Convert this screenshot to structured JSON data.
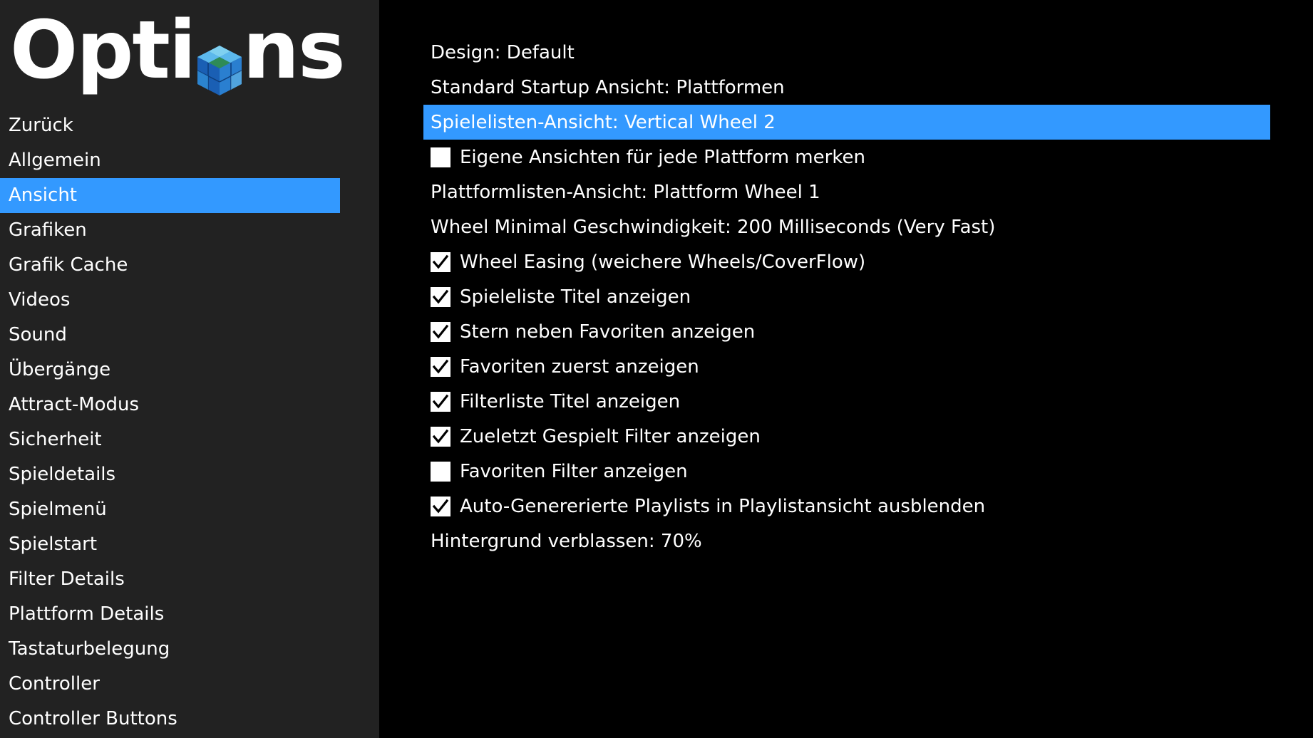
{
  "sidebar": {
    "logo": {
      "text_before": "Opti",
      "text_after": "ns",
      "icon": "cube-icon",
      "icon_colors": [
        "#1a5fb4",
        "#3ba3e8",
        "#7fd0f0",
        "#2e8b57"
      ]
    },
    "items": [
      {
        "label": "Zurück",
        "name": "zurueck",
        "selected": false
      },
      {
        "label": "Allgemein",
        "name": "allgemein",
        "selected": false
      },
      {
        "label": "Ansicht",
        "name": "ansicht",
        "selected": true
      },
      {
        "label": "Grafiken",
        "name": "grafiken",
        "selected": false
      },
      {
        "label": "Grafik Cache",
        "name": "grafik-cache",
        "selected": false
      },
      {
        "label": "Videos",
        "name": "videos",
        "selected": false
      },
      {
        "label": "Sound",
        "name": "sound",
        "selected": false
      },
      {
        "label": "Übergänge",
        "name": "uebergaenge",
        "selected": false
      },
      {
        "label": "Attract-Modus",
        "name": "attract-modus",
        "selected": false
      },
      {
        "label": "Sicherheit",
        "name": "sicherheit",
        "selected": false
      },
      {
        "label": "Spieldetails",
        "name": "spieldetails",
        "selected": false
      },
      {
        "label": "Spielmenü",
        "name": "spielmenue",
        "selected": false
      },
      {
        "label": "Spielstart",
        "name": "spielstart",
        "selected": false
      },
      {
        "label": "Filter Details",
        "name": "filter-details",
        "selected": false
      },
      {
        "label": "Plattform Details",
        "name": "plattform-details",
        "selected": false
      },
      {
        "label": "Tastaturbelegung",
        "name": "tastaturbelegung",
        "selected": false
      },
      {
        "label": "Controller",
        "name": "controller",
        "selected": false
      },
      {
        "label": "Controller Buttons",
        "name": "controller-buttons",
        "selected": false
      }
    ]
  },
  "options": [
    {
      "label": "Design: Default",
      "name": "design-option",
      "type": "value",
      "selected": false
    },
    {
      "label": "Standard Startup Ansicht: Plattformen",
      "name": "startup-view-option",
      "type": "value",
      "selected": false
    },
    {
      "label": "Spielelisten-Ansicht: Vertical Wheel 2",
      "name": "game-list-view-option",
      "type": "value",
      "selected": true
    },
    {
      "label": "Eigene Ansichten für jede Plattform merken",
      "name": "remember-views-checkbox",
      "type": "checkbox",
      "checked": false,
      "selected": false
    },
    {
      "label": "Plattformlisten-Ansicht: Plattform Wheel 1",
      "name": "platform-list-view-option",
      "type": "value",
      "selected": false
    },
    {
      "label": "Wheel Minimal Geschwindigkeit: 200 Milliseconds (Very Fast)",
      "name": "wheel-speed-option",
      "type": "value",
      "selected": false
    },
    {
      "label": "Wheel Easing (weichere Wheels/CoverFlow)",
      "name": "wheel-easing-checkbox",
      "type": "checkbox",
      "checked": true,
      "selected": false
    },
    {
      "label": "Spieleliste Titel anzeigen",
      "name": "show-game-list-title-checkbox",
      "type": "checkbox",
      "checked": true,
      "selected": false
    },
    {
      "label": "Stern neben Favoriten anzeigen",
      "name": "show-favorite-star-checkbox",
      "type": "checkbox",
      "checked": true,
      "selected": false
    },
    {
      "label": "Favoriten zuerst anzeigen",
      "name": "favorites-first-checkbox",
      "type": "checkbox",
      "checked": true,
      "selected": false
    },
    {
      "label": "Filterliste Titel anzeigen",
      "name": "show-filter-list-title-checkbox",
      "type": "checkbox",
      "checked": true,
      "selected": false
    },
    {
      "label": "Zueletzt Gespielt Filter anzeigen",
      "name": "show-recently-played-filter-checkbox",
      "type": "checkbox",
      "checked": true,
      "selected": false
    },
    {
      "label": "Favoriten Filter anzeigen",
      "name": "show-favorites-filter-checkbox",
      "type": "checkbox",
      "checked": false,
      "selected": false
    },
    {
      "label": "Auto-Genererierte Playlists in Playlistansicht ausblenden",
      "name": "hide-auto-playlists-checkbox",
      "type": "checkbox",
      "checked": true,
      "selected": false
    },
    {
      "label": "Hintergrund verblassen: 70%",
      "name": "background-fade-option",
      "type": "value",
      "selected": false
    }
  ],
  "colors": {
    "sidebar_bg": "#222222",
    "content_bg": "#000000",
    "highlight": "#3399ff",
    "text": "#ffffff"
  }
}
